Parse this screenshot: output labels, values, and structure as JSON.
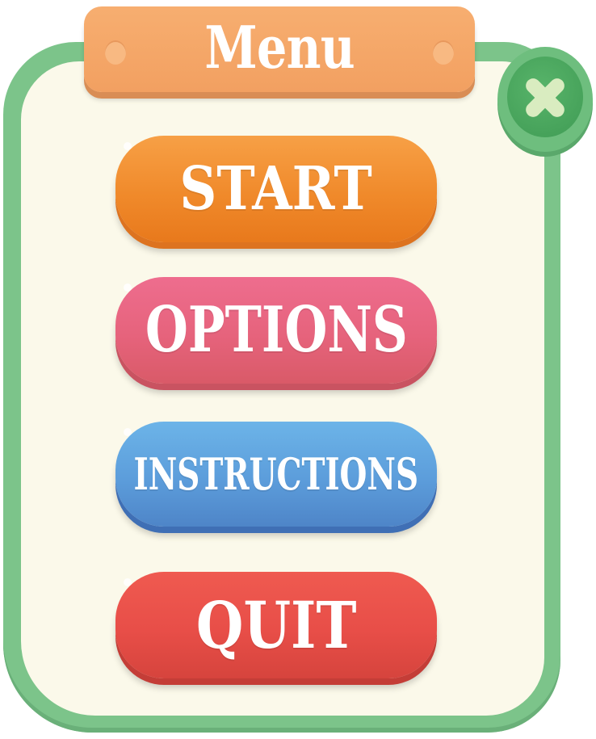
{
  "title": "Menu",
  "close_icon": "close-x-icon",
  "colors": {
    "panel_border": "#7cc48a",
    "panel_fill": "#fbf9ea",
    "banner": "#f2a061",
    "close_button": "#4caa5f",
    "start": "#f08a2b",
    "options": "#e6637c",
    "instructions": "#5c9ddb",
    "quit": "#e84e48"
  },
  "buttons": {
    "start": "START",
    "options": "OPTIONS",
    "instructions": "INSTRUCTIONS",
    "quit": "QUIT"
  }
}
